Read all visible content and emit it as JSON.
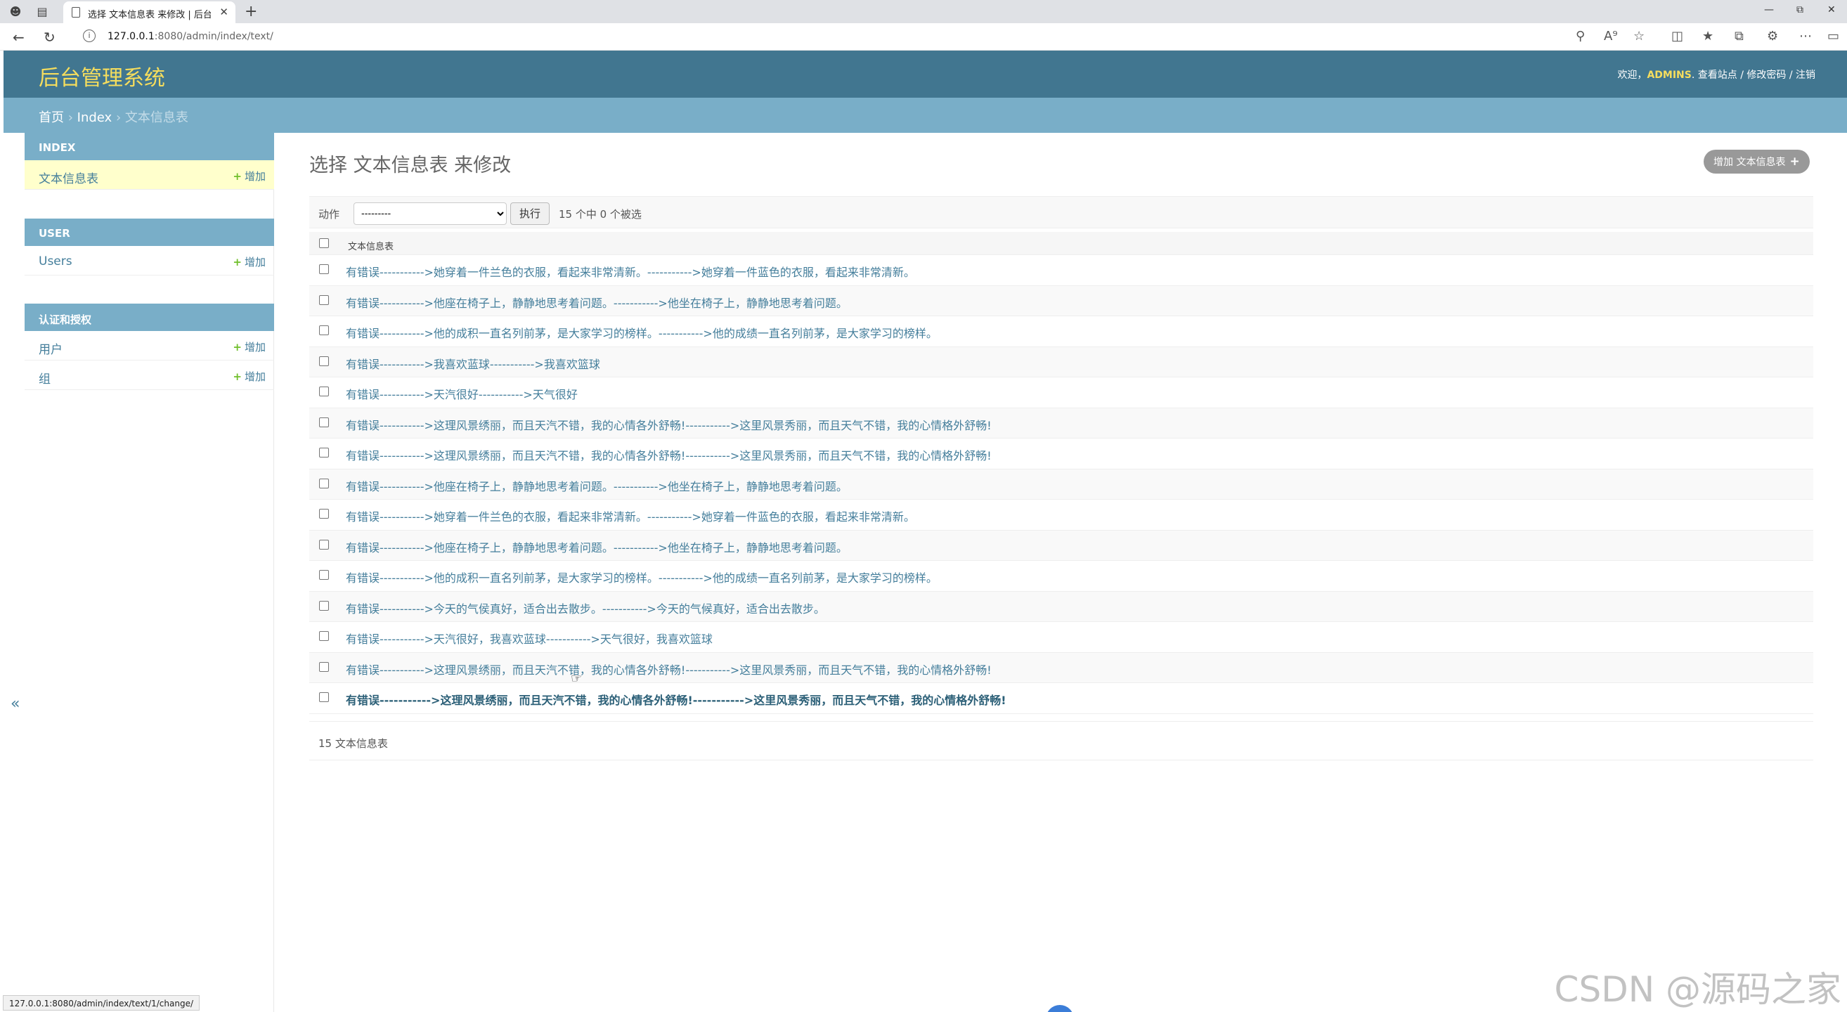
{
  "browser": {
    "tab_title": "选择 文本信息表 来修改 | 后台管",
    "url_host": "127.0.0.1",
    "url_path": ":8080/admin/index/text/",
    "status_url": "127.0.0.1:8080/admin/index/text/1/change/"
  },
  "header": {
    "brand": "后台管理系统",
    "welcome": "欢迎，",
    "username": "ADMINS",
    "view_site": "查看站点",
    "change_password": "修改密码",
    "logout": "注销",
    "sep": " / "
  },
  "breadcrumb": {
    "home": "首页",
    "app": "Index",
    "current": "文本信息表",
    "sep": " › "
  },
  "sidebar": {
    "add_label": "增加",
    "modules": [
      {
        "caption": "INDEX",
        "items": [
          {
            "label": "文本信息表",
            "selected": true
          }
        ]
      },
      {
        "caption": "USER",
        "items": [
          {
            "label": "Users",
            "selected": false
          }
        ]
      },
      {
        "caption": "认证和授权",
        "items": [
          {
            "label": "用户",
            "selected": false
          },
          {
            "label": "组",
            "selected": false
          }
        ]
      }
    ],
    "collapse": "«"
  },
  "main": {
    "title": "选择 文本信息表 来修改",
    "add_button": "增加 文本信息表",
    "actions_label": "动作",
    "action_select_value": "---------",
    "go_button": "执行",
    "selection_count": "15 个中 0 个被选",
    "column_header": "文本信息表",
    "rows": [
      "有错误----------->她穿着一件兰色的衣服，看起来非常清新。----------->她穿着一件蓝色的衣服，看起来非常清新。",
      "有错误----------->他座在椅子上，静静地思考着问题。----------->他坐在椅子上，静静地思考着问题。",
      "有错误----------->他的成积一直名列前茅，是大家学习的榜样。----------->他的成绩一直名列前茅，是大家学习的榜样。",
      "有错误----------->我喜欢蓝球----------->我喜欢篮球",
      "有错误----------->天汽很好----------->天气很好",
      "有错误----------->这理风景绣丽，而且天汽不错，我的心情各外舒畅!----------->这里风景秀丽，而且天气不错，我的心情格外舒畅!",
      "有错误----------->这理风景绣丽，而且天汽不错，我的心情各外舒畅!----------->这里风景秀丽，而且天气不错，我的心情格外舒畅!",
      "有错误----------->他座在椅子上，静静地思考着问题。----------->他坐在椅子上，静静地思考着问题。",
      "有错误----------->她穿着一件兰色的衣服，看起来非常清新。----------->她穿着一件蓝色的衣服，看起来非常清新。",
      "有错误----------->他座在椅子上，静静地思考着问题。----------->他坐在椅子上，静静地思考着问题。",
      "有错误----------->他的成积一直名列前茅，是大家学习的榜样。----------->他的成绩一直名列前茅，是大家学习的榜样。",
      "有错误----------->今天的气侯真好，适合出去散步。----------->今天的气候真好，适合出去散步。",
      "有错误----------->天汽很好，我喜欢蓝球----------->天气很好，我喜欢篮球",
      "有错误----------->这理风景绣丽，而且天汽不错，我的心情各外舒畅!----------->这里风景秀丽，而且天气不错，我的心情格外舒畅!",
      "有错误----------->这理风景绣丽，而且天汽不错，我的心情各外舒畅!----------->这里风景秀丽，而且天气不错，我的心情格外舒畅!"
    ],
    "hovered_row": 14,
    "paginator": "15 文本信息表"
  },
  "watermark": "CSDN @源码之家",
  "colors": {
    "header_bg": "#417690",
    "breadcrumb_bg": "#79aec8",
    "brand_yellow": "#f5dd5d",
    "link": "#447e9b",
    "add_green": "#70bf2b",
    "selected_row": "#ffffcc"
  }
}
